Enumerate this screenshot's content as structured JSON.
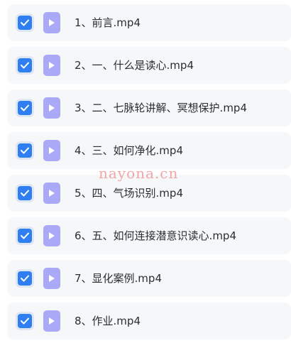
{
  "files": [
    {
      "name": "1、前言.mp4",
      "checked": true
    },
    {
      "name": "2、一、什么是读心.mp4",
      "checked": true
    },
    {
      "name": "3、二、七脉轮讲解、冥想保护.mp4",
      "checked": true
    },
    {
      "name": "4、三、如何净化.mp4",
      "checked": true
    },
    {
      "name": "5、四、气场识别.mp4",
      "checked": true
    },
    {
      "name": "6、五、如何连接潜意识读心.mp4",
      "checked": true
    },
    {
      "name": "7、显化案例.mp4",
      "checked": true
    },
    {
      "name": "8、作业.mp4",
      "checked": true
    }
  ],
  "watermark": "nayona.cn",
  "colors": {
    "checkbox": "#2f7ff0",
    "file_icon": "#a9a9f7",
    "row_background": "#f6f7f9"
  },
  "icons": {
    "checkbox": "checkmark-icon",
    "file": "video-file-icon"
  }
}
